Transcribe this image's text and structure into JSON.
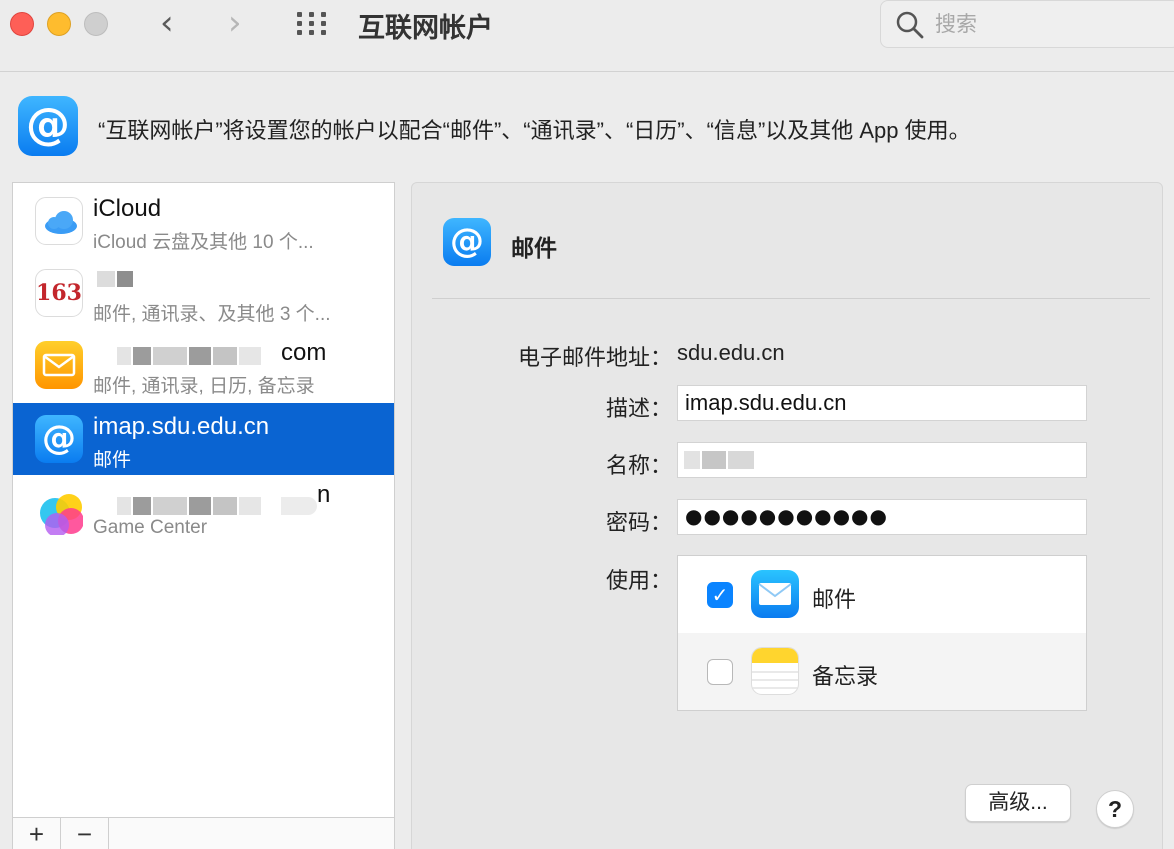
{
  "window": {
    "title": "互联网帐户"
  },
  "search": {
    "placeholder": "搜索"
  },
  "header": {
    "description": "“互联网帐户”将设置您的帐户以配合“邮件”、“通讯录”、“日历”、“信息”以及其他 App 使用。"
  },
  "accounts": [
    {
      "title": "iCloud",
      "subtitle": "iCloud 云盘及其他 10 个...",
      "icon": "icloud-icon",
      "selected": false
    },
    {
      "title": "",
      "subtitle": "邮件, 通讯录、及其他 3 个...",
      "icon": "mail-163-icon",
      "icon_text": "163",
      "selected": false
    },
    {
      "title": "com",
      "subtitle": "邮件, 通讯录, 日历, 备忘录",
      "icon": "mail-envelope-icon",
      "selected": false
    },
    {
      "title": "imap.sdu.edu.cn",
      "subtitle": "邮件",
      "icon": "at-sign-icon",
      "selected": true
    },
    {
      "title": "n",
      "subtitle": "Game Center",
      "icon": "game-center-icon",
      "selected": false
    }
  ],
  "list_footer": {
    "add_label": "+",
    "remove_label": "−"
  },
  "detail": {
    "title": "邮件",
    "fields": {
      "email_label": "电子邮件地址：",
      "email_value": "sdu.edu.cn",
      "description_label": "描述：",
      "description_value": "imap.sdu.edu.cn",
      "name_label": "名称：",
      "name_value": "",
      "password_label": "密码：",
      "password_value": "●●●●●●●●●●●",
      "use_label": "使用："
    },
    "apps": [
      {
        "label": "邮件",
        "checked": true,
        "icon": "mail-app-icon"
      },
      {
        "label": "备忘录",
        "checked": false,
        "icon": "notes-app-icon"
      }
    ],
    "advanced_label": "高级...",
    "help_label": "?"
  },
  "colors": {
    "selection": "#0a64d2",
    "checkbox_on": "#0a84ff",
    "accent_at": "#0a7cf0"
  }
}
